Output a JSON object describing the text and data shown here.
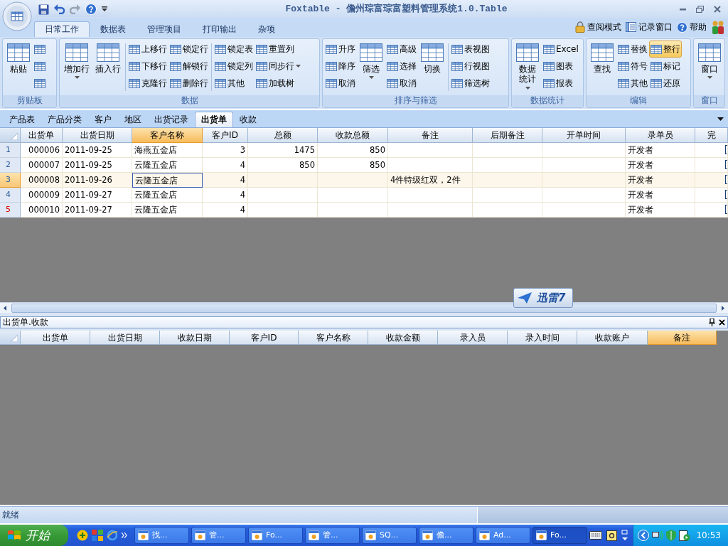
{
  "title_bar": {
    "title": "Foxtable - 儋州琮富琮富塑料管理系统1.0.Table"
  },
  "ribbon_tabs": [
    {
      "label": "日常工作",
      "selected": true
    },
    {
      "label": "数据表",
      "selected": false
    },
    {
      "label": "管理项目",
      "selected": false
    },
    {
      "label": "打印输出",
      "selected": false
    },
    {
      "label": "杂项",
      "selected": false
    }
  ],
  "ribbon_links": [
    {
      "label": "查阅模式"
    },
    {
      "label": "记录窗口"
    },
    {
      "label": "帮助"
    }
  ],
  "ribbon_groups": [
    {
      "label": "剪贴板",
      "columns": [
        {
          "kind": "large",
          "label": "粘贴",
          "dropdown": false,
          "on": false
        },
        {
          "kind": "stack",
          "items": [
            {
              "on": false,
              "dropdown": false
            },
            {
              "on": false,
              "dropdown": false
            },
            {
              "on": false,
              "dropdown": false
            }
          ]
        }
      ]
    },
    {
      "label": "数据",
      "columns": [
        {
          "kind": "large",
          "label": "增加行",
          "dropdown": true,
          "on": false
        },
        {
          "kind": "large",
          "label": "插入行",
          "dropdown": false,
          "on": false
        },
        {
          "kind": "separator"
        },
        {
          "kind": "stack",
          "items": [
            {
              "label": "上移行",
              "on": false,
              "dropdown": false
            },
            {
              "label": "下移行",
              "on": false,
              "dropdown": false
            },
            {
              "label": "克隆行",
              "on": false,
              "dropdown": false
            }
          ]
        },
        {
          "kind": "stack",
          "items": [
            {
              "label": "锁定行",
              "on": false,
              "dropdown": false
            },
            {
              "label": "解锁行",
              "on": false,
              "dropdown": false
            },
            {
              "label": "删除行",
              "on": false,
              "dropdown": false
            }
          ]
        },
        {
          "kind": "separator"
        },
        {
          "kind": "stack",
          "items": [
            {
              "label": "锁定表",
              "on": false,
              "dropdown": false
            },
            {
              "label": "锁定列",
              "on": false,
              "dropdown": false
            },
            {
              "label": "其他",
              "on": false,
              "dropdown": false
            }
          ]
        },
        {
          "kind": "stack",
          "items": [
            {
              "label": "重置列",
              "on": false,
              "dropdown": false
            },
            {
              "label": "同步行",
              "on": false,
              "dropdown": true
            },
            {
              "label": "加载树",
              "on": false,
              "dropdown": false
            }
          ]
        }
      ]
    },
    {
      "label": "排序与筛选",
      "columns": [
        {
          "kind": "stack",
          "items": [
            {
              "label": "升序",
              "on": false,
              "dropdown": false
            },
            {
              "label": "降序",
              "on": false,
              "dropdown": false
            },
            {
              "label": "取消",
              "on": false,
              "dropdown": false
            }
          ]
        },
        {
          "kind": "large",
          "label": "筛选",
          "dropdown": true,
          "on": false
        },
        {
          "kind": "stack",
          "items": [
            {
              "label": "高级",
              "on": false,
              "dropdown": false
            },
            {
              "label": "选择",
              "on": false,
              "dropdown": false
            },
            {
              "label": "取消",
              "on": false,
              "dropdown": false
            }
          ]
        },
        {
          "kind": "large",
          "label": "切换",
          "dropdown": false,
          "on": false
        },
        {
          "kind": "separator"
        },
        {
          "kind": "stack",
          "items": [
            {
              "label": "表视图",
              "on": false,
              "dropdown": false
            },
            {
              "label": "行视图",
              "on": false,
              "dropdown": false
            },
            {
              "label": "筛选树",
              "on": false,
              "dropdown": false
            }
          ]
        }
      ]
    },
    {
      "label": "数据统计",
      "columns": [
        {
          "kind": "large",
          "label": "数据统计",
          "dropdown": true,
          "on": false
        },
        {
          "kind": "stack",
          "items": [
            {
              "label": "Excel",
              "on": false,
              "dropdown": false
            },
            {
              "label": "图表",
              "on": false,
              "dropdown": false
            },
            {
              "label": "报表",
              "on": false,
              "dropdown": false
            }
          ]
        }
      ]
    },
    {
      "label": "编辑",
      "columns": [
        {
          "kind": "large",
          "label": "查找",
          "dropdown": false,
          "on": false
        },
        {
          "kind": "stack",
          "items": [
            {
              "label": "替换",
              "on": false,
              "dropdown": false
            },
            {
              "label": "符号",
              "on": false,
              "dropdown": false
            },
            {
              "label": "其他",
              "on": false,
              "dropdown": false
            }
          ]
        },
        {
          "kind": "stack",
          "items": [
            {
              "label": "整行",
              "on": true,
              "dropdown": false
            },
            {
              "label": "标记",
              "on": false,
              "dropdown": false
            },
            {
              "label": "还原",
              "on": false,
              "dropdown": false
            }
          ]
        }
      ]
    },
    {
      "label": "窗口",
      "columns": [
        {
          "kind": "large",
          "label": "窗口",
          "dropdown": true,
          "on": false
        }
      ]
    }
  ],
  "sheet_tabs": [
    {
      "label": "产品表",
      "selected": false
    },
    {
      "label": "产品分类",
      "selected": false
    },
    {
      "label": "客户",
      "selected": false
    },
    {
      "label": "地区",
      "selected": false
    },
    {
      "label": "出货记录",
      "selected": false
    },
    {
      "label": "出货单",
      "selected": true
    },
    {
      "label": "收款",
      "selected": false
    }
  ],
  "main_table": {
    "columns": [
      {
        "label": "出货单",
        "selected": false
      },
      {
        "label": "出货日期",
        "selected": false
      },
      {
        "label": "客户名称",
        "selected": true
      },
      {
        "label": "客户ID",
        "selected": false
      },
      {
        "label": "总额",
        "selected": false
      },
      {
        "label": "收款总额",
        "selected": false
      },
      {
        "label": "备注",
        "selected": false
      },
      {
        "label": "后期备注",
        "selected": false
      },
      {
        "label": "开单时间",
        "selected": false
      },
      {
        "label": "录单员",
        "selected": false
      },
      {
        "label": "完",
        "selected": false
      }
    ],
    "rows": [
      {
        "number": "1",
        "color": "#2f5f9f",
        "selected": false,
        "cells": [
          "000006",
          "2011-09-25",
          "海燕五金店",
          "3",
          "1475",
          "850",
          "",
          "",
          "",
          "开发者"
        ]
      },
      {
        "number": "2",
        "color": "#2f5f9f",
        "selected": false,
        "cells": [
          "000007",
          "2011-09-25",
          "云隆五金店",
          "4",
          "850",
          "850",
          "",
          "",
          "",
          "开发者"
        ]
      },
      {
        "number": "3",
        "color": "#2f5f9f",
        "selected": true,
        "cells": [
          "000008",
          "2011-09-26",
          "云隆五金店",
          "4",
          "",
          "",
          "4件特级红双，2件",
          "",
          "",
          "开发者"
        ]
      },
      {
        "number": "4",
        "color": "#2f5f9f",
        "selected": false,
        "cells": [
          "000009",
          "2011-09-27",
          "云隆五金店",
          "4",
          "",
          "",
          "",
          "",
          "",
          "开发者"
        ]
      },
      {
        "number": "5",
        "color": "#e00000",
        "selected": false,
        "cells": [
          "000010",
          "2011-09-27",
          "云隆五金店",
          "4",
          "",
          "",
          "",
          "",
          "",
          "开发者"
        ]
      }
    ]
  },
  "floating_widget": {
    "label": "迅雷7"
  },
  "sub_panel": {
    "title": "出货单.收款",
    "columns": [
      {
        "label": "出货单",
        "selected": false
      },
      {
        "label": "出货日期",
        "selected": false
      },
      {
        "label": "收款日期",
        "selected": false
      },
      {
        "label": "客户ID",
        "selected": false
      },
      {
        "label": "客户名称",
        "selected": false
      },
      {
        "label": "收款金额",
        "selected": false
      },
      {
        "label": "录入员",
        "selected": false
      },
      {
        "label": "录入时间",
        "selected": false
      },
      {
        "label": "收款账户",
        "selected": false
      },
      {
        "label": "备注",
        "selected": true
      }
    ]
  },
  "status_bar": {
    "text": "就绪"
  },
  "taskbar": {
    "start": "开始",
    "tasks": [
      {
        "label": "找...",
        "selected": false
      },
      {
        "label": "管...",
        "selected": false
      },
      {
        "label": "Fo...",
        "selected": false
      },
      {
        "label": "管...",
        "selected": false
      },
      {
        "label": "SQ...",
        "selected": false
      },
      {
        "label": "儋...",
        "selected": false
      },
      {
        "label": "Ad...",
        "selected": false
      },
      {
        "label": "Fo...",
        "selected": true
      }
    ],
    "clock": "10:53"
  }
}
